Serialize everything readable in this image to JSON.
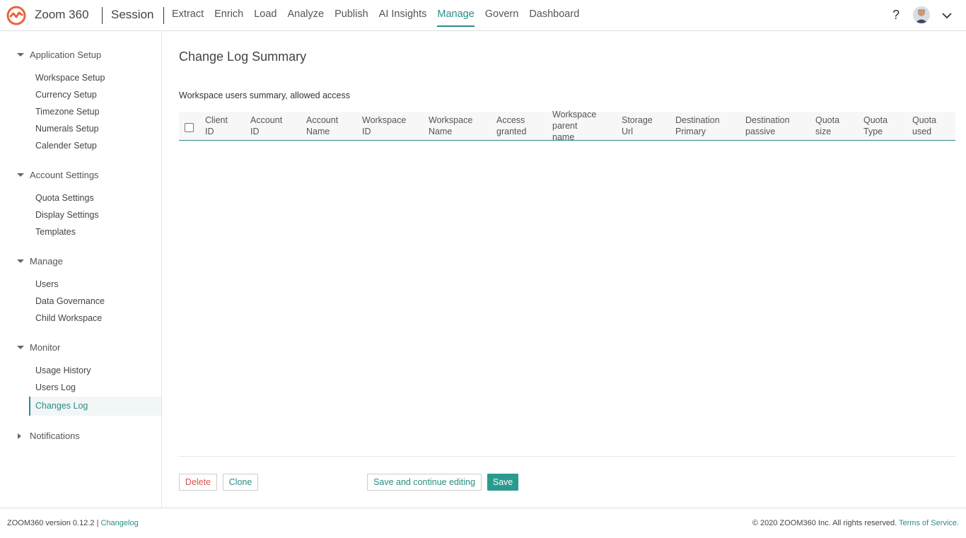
{
  "header": {
    "app_title": "Zoom 360",
    "session": "Session",
    "nav": [
      "Extract",
      "Enrich",
      "Load",
      "Analyze",
      "Publish",
      "AI Insights",
      "Manage",
      "Govern",
      "Dashboard"
    ],
    "active_nav": "Manage",
    "help": "?",
    "accent_color": "#2a8c86",
    "logo_color": "#e8643c"
  },
  "sidebar": {
    "sections": [
      {
        "title": "Application Setup",
        "expanded": true,
        "items": [
          "Workspace Setup",
          "Currency Setup",
          "Timezone Setup",
          "Numerals Setup",
          "Calender Setup"
        ]
      },
      {
        "title": "Account Settings",
        "expanded": true,
        "items": [
          "Quota Settings",
          "Display Settings",
          "Templates"
        ]
      },
      {
        "title": "Manage",
        "expanded": true,
        "items": [
          "Users",
          "Data Governance",
          "Child Workspace"
        ]
      },
      {
        "title": "Monitor",
        "expanded": true,
        "items": [
          "Usage History",
          "Users Log",
          "Changes Log"
        ]
      },
      {
        "title": "Notifications",
        "expanded": false,
        "items": []
      }
    ],
    "active_item": "Changes Log"
  },
  "main": {
    "title": "Change Log Summary",
    "subtitle": "Workspace users summary, allowed access",
    "columns": [
      "Client\nID",
      "Account\nID",
      "Account\nName",
      "Workspace\nID",
      "Workspace\nName",
      "Access\ngranted",
      "Workspace\nparent\nname",
      "Storage\nUrl",
      "Destination\nPrimary",
      "Destination\npassive",
      "Quota\nsize",
      "Quota\nType",
      "Quota\nused"
    ],
    "rows": [],
    "buttons": {
      "delete": "Delete",
      "clone": "Clone",
      "save_continue": "Save and continue editing",
      "save": "Save"
    }
  },
  "footer": {
    "version": "ZOOM360 version 0.12.2",
    "separator": "|",
    "changelog": "Changelog",
    "copyright": "© 2020 ZOOM360 Inc. All rights reserved.",
    "terms": "Terms of Service."
  }
}
